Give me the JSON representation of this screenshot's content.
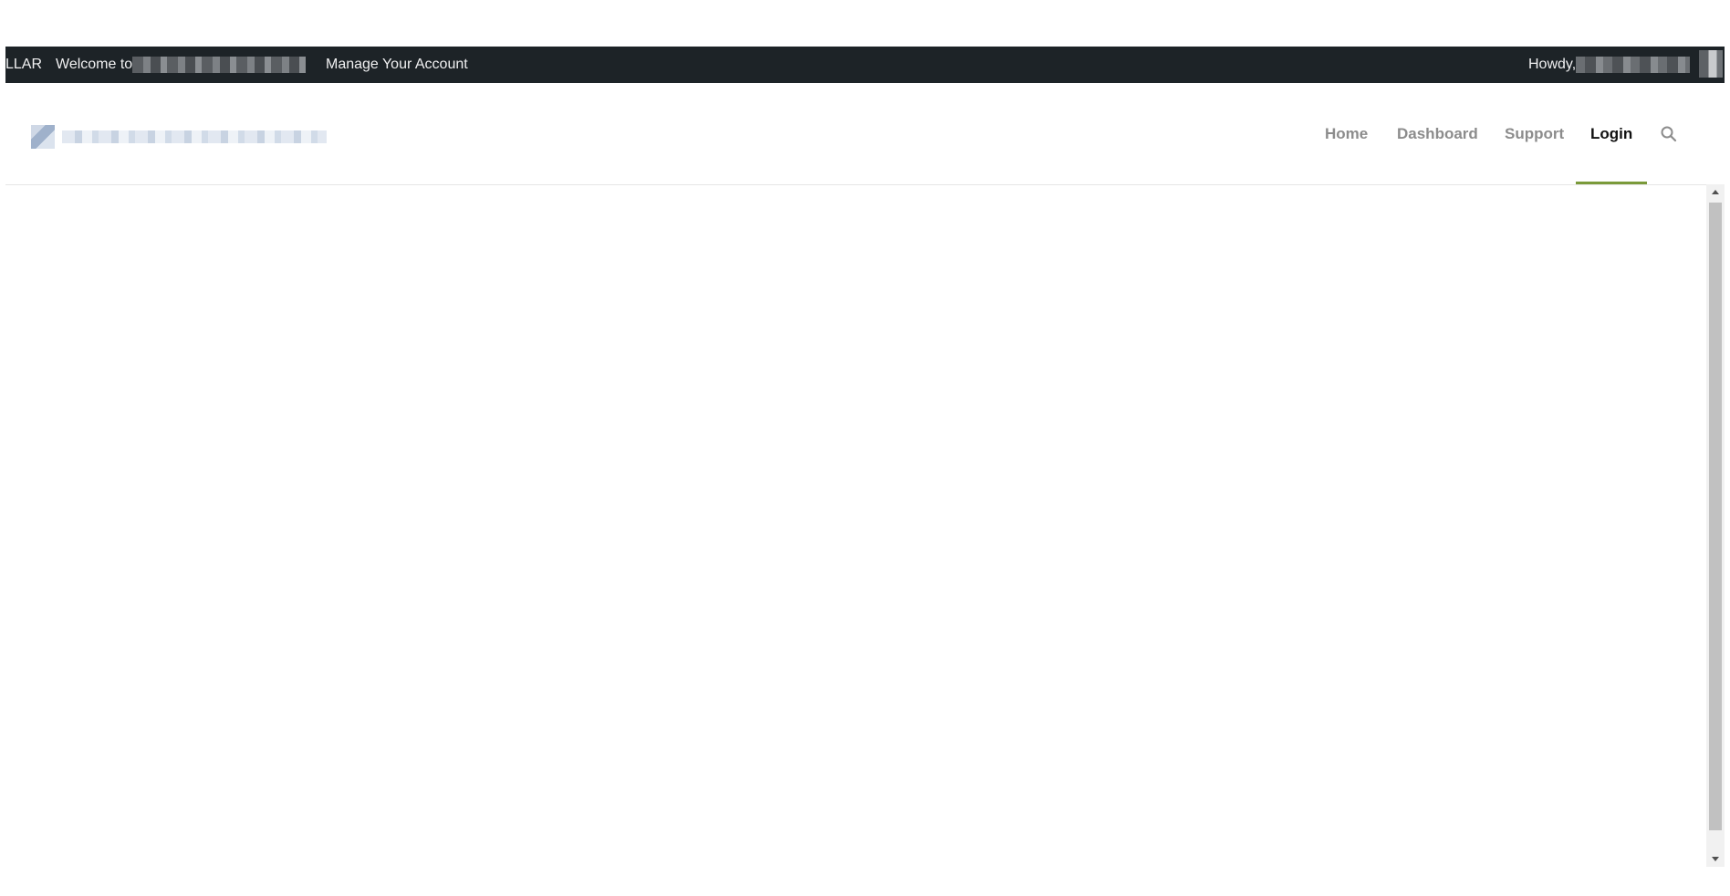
{
  "adminbar": {
    "site_label": "LLAR",
    "welcome_label": "Welcome to",
    "manage_label": "Manage Your Account",
    "howdy_label": "Howdy,"
  },
  "nav": {
    "items": [
      {
        "label": "Home"
      },
      {
        "label": "Dashboard"
      },
      {
        "label": "Support"
      },
      {
        "label": "Login"
      }
    ],
    "active": "Login",
    "accent_color": "#7a9a3a"
  },
  "icons": {
    "search": "search-icon"
  }
}
